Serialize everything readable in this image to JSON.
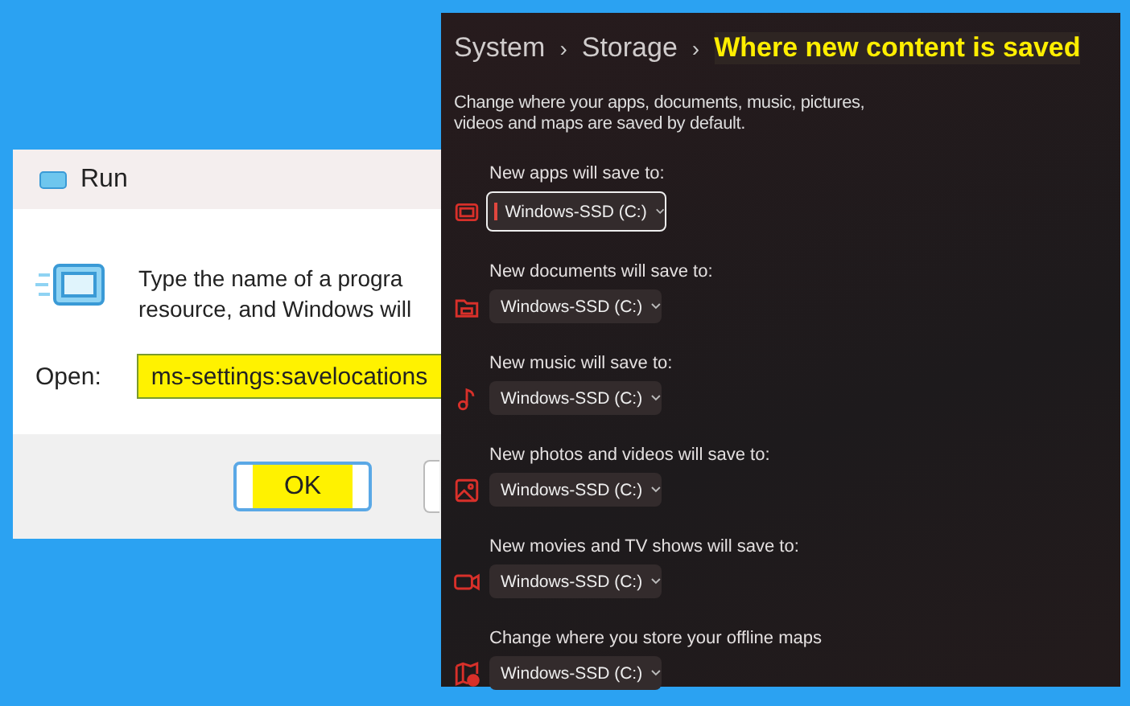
{
  "run_dialog": {
    "title": "Run",
    "message_lines": [
      "Type the name of a progra",
      "resource, and Windows will"
    ],
    "open_label": "Open:",
    "open_value": "ms-settings:savelocations",
    "open_highlighted": true,
    "buttons": [
      {
        "label": "OK",
        "highlighted": true,
        "focused": true
      }
    ]
  },
  "settings": {
    "breadcrumb": [
      {
        "label": "System",
        "current": false
      },
      {
        "label": "Storage",
        "current": false
      },
      {
        "label": "Where new content is saved",
        "current": true
      }
    ],
    "separator": "›",
    "description": "Change where your apps, documents, music, pictures, videos and maps are saved by default.",
    "locations": [
      {
        "label": "New apps will save to:",
        "kind": "app",
        "value": "Windows-SSD (C:)",
        "focused": true
      },
      {
        "label": "New documents will save to:",
        "kind": "document",
        "value": "Windows-SSD (C:)",
        "focused": false
      },
      {
        "label": "New music will save to:",
        "kind": "music",
        "value": "Windows-SSD (C:)",
        "focused": false
      },
      {
        "label": "New photos and videos will save to:",
        "kind": "photo",
        "value": "Windows-SSD (C:)",
        "focused": false
      },
      {
        "label": "New movies and TV shows will save to:",
        "kind": "video",
        "value": "Windows-SSD (C:)",
        "focused": false
      },
      {
        "label": "Change where you store your offline maps",
        "kind": "map",
        "value": "Windows-SSD (C:)",
        "focused": false
      }
    ]
  }
}
